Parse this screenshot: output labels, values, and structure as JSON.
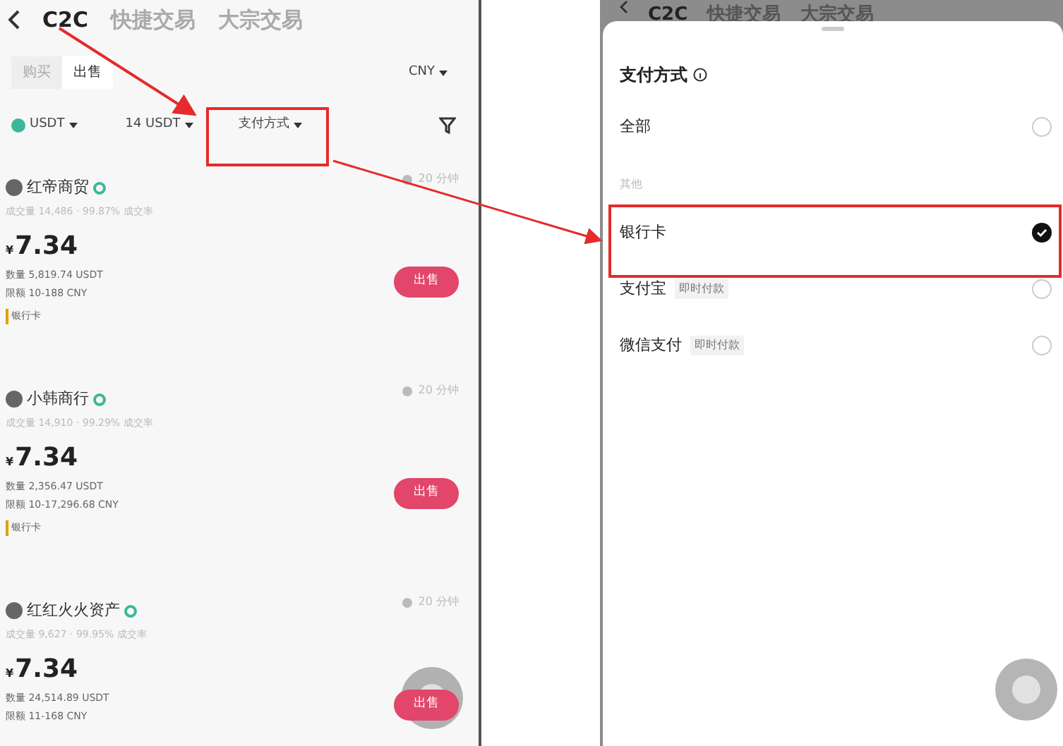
{
  "left_screen": {
    "tabs": [
      {
        "label": "C2C",
        "selected": true
      },
      {
        "label": "快捷交易",
        "selected": false
      },
      {
        "label": "大宗交易",
        "selected": false
      }
    ],
    "side_tabs": [
      {
        "label": "购买",
        "selected": false
      },
      {
        "label": "出售",
        "selected": true
      }
    ],
    "currency": "CNY",
    "filters": [
      "USDT",
      "14 USDT",
      "支付方式"
    ],
    "ads": [
      {
        "merchant": "红帝商贸",
        "stats": "成交量 14,486 · 99.87% 成交率",
        "time": "20 分钟",
        "currency_symbol": "¥",
        "price": "7.34",
        "quantity": "数量 5,819.74 USDT",
        "limit": "限额 10-188 CNY",
        "payment": "银行卡",
        "action": "出售"
      },
      {
        "merchant": "小韩商行",
        "stats": "成交量 14,910 · 99.29% 成交率",
        "time": "20 分钟",
        "currency_symbol": "¥",
        "price": "7.34",
        "quantity": "数量 2,356.47 USDT",
        "limit": "限额 10-17,296.68 CNY",
        "payment": "银行卡",
        "action": "出售"
      },
      {
        "merchant": "红红火火资产",
        "stats": "成交量 9,627 · 99.95% 成交率",
        "time": "20 分钟",
        "currency_symbol": "¥",
        "price": "7.34",
        "quantity": "数量 24,514.89 USDT",
        "limit": "限额 11-168 CNY",
        "action": "出售"
      }
    ]
  },
  "right_screen": {
    "tabs": [
      {
        "label": "C2C",
        "selected": true
      },
      {
        "label": "快捷交易",
        "selected": false
      },
      {
        "label": "大宗交易",
        "selected": false
      }
    ],
    "sheet": {
      "title": "支付方式",
      "all_option": {
        "label": "全部",
        "selected": false
      },
      "section": "其他",
      "options": [
        {
          "label": "银行卡",
          "selected": true
        },
        {
          "label": "支付宝",
          "tag": "即时付款",
          "selected": false
        },
        {
          "label": "微信支付",
          "tag": "即时付款",
          "selected": false
        }
      ]
    }
  }
}
